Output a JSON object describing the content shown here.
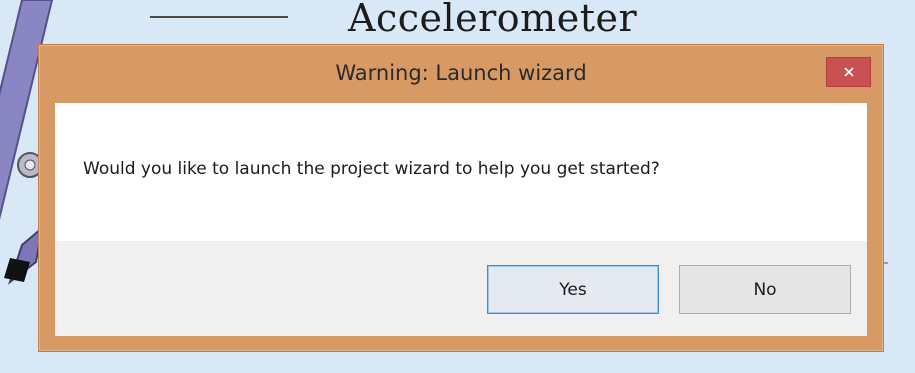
{
  "background": {
    "heading": "Accelerometer"
  },
  "dialog": {
    "title": "Warning: Launch wizard",
    "close_icon": "close-icon",
    "message": "Would you like to launch the project wizard to help you get started?",
    "buttons": {
      "yes_label": "Yes",
      "no_label": "No"
    },
    "colors": {
      "frame": "#d79a65",
      "close_button": "#c75050",
      "focus_border": "#3c8fd6"
    }
  }
}
